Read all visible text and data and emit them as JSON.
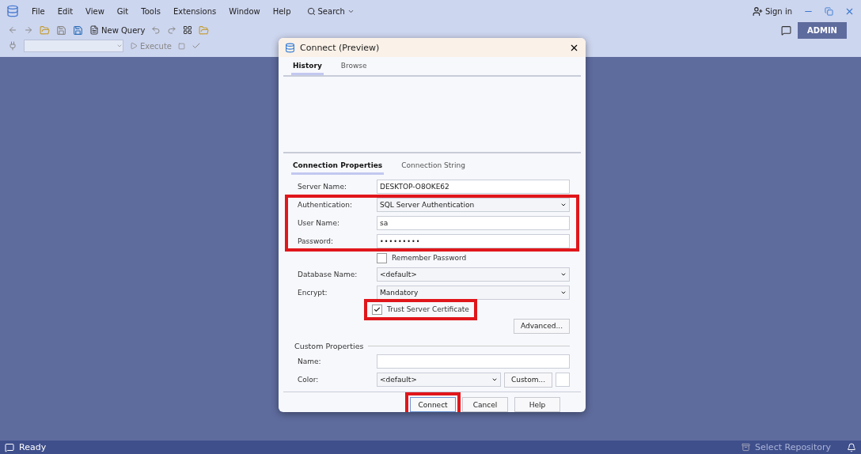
{
  "menu": {
    "items": [
      "File",
      "Edit",
      "View",
      "Git",
      "Tools",
      "Extensions",
      "Window",
      "Help"
    ],
    "search": "Search",
    "sign_in": "Sign in",
    "admin": "ADMIN"
  },
  "toolbar": {
    "new_query": "New Query",
    "execute": "Execute"
  },
  "dialog": {
    "title": "Connect (Preview)",
    "tabs": [
      {
        "label": "History",
        "selected": true
      },
      {
        "label": "Browse",
        "selected": false
      }
    ],
    "property_tabs": [
      {
        "label": "Connection Properties",
        "selected": true
      },
      {
        "label": "Connection String",
        "selected": false
      }
    ],
    "fields": [
      {
        "kind": "text",
        "label": "Server Name:",
        "value": "DESKTOP-O8OKE62"
      },
      {
        "kind": "dropdown",
        "label": "Authentication:",
        "value": "SQL Server Authentication"
      },
      {
        "kind": "text",
        "label": "User Name:",
        "value": "sa"
      },
      {
        "kind": "password",
        "label": "Password:",
        "value": "•••••••••"
      },
      {
        "kind": "checkbox",
        "label": "Remember Password",
        "checked": false
      },
      {
        "kind": "dropdown",
        "label": "Database Name:",
        "value": "<default>"
      },
      {
        "kind": "dropdown",
        "label": "Encrypt:",
        "value": "Mandatory"
      },
      {
        "kind": "checkbox",
        "label": "Trust Server Certificate",
        "checked": true
      }
    ],
    "advanced": "Advanced...",
    "custom_properties": {
      "title": "Custom Properties",
      "name_label": "Name:",
      "color_label": "Color:",
      "color_value": "<default>",
      "custom_button": "Custom..."
    },
    "buttons": [
      "Connect",
      "Cancel",
      "Help"
    ]
  },
  "status_bar": {
    "text": "Ready",
    "repository": "Select Repository"
  }
}
